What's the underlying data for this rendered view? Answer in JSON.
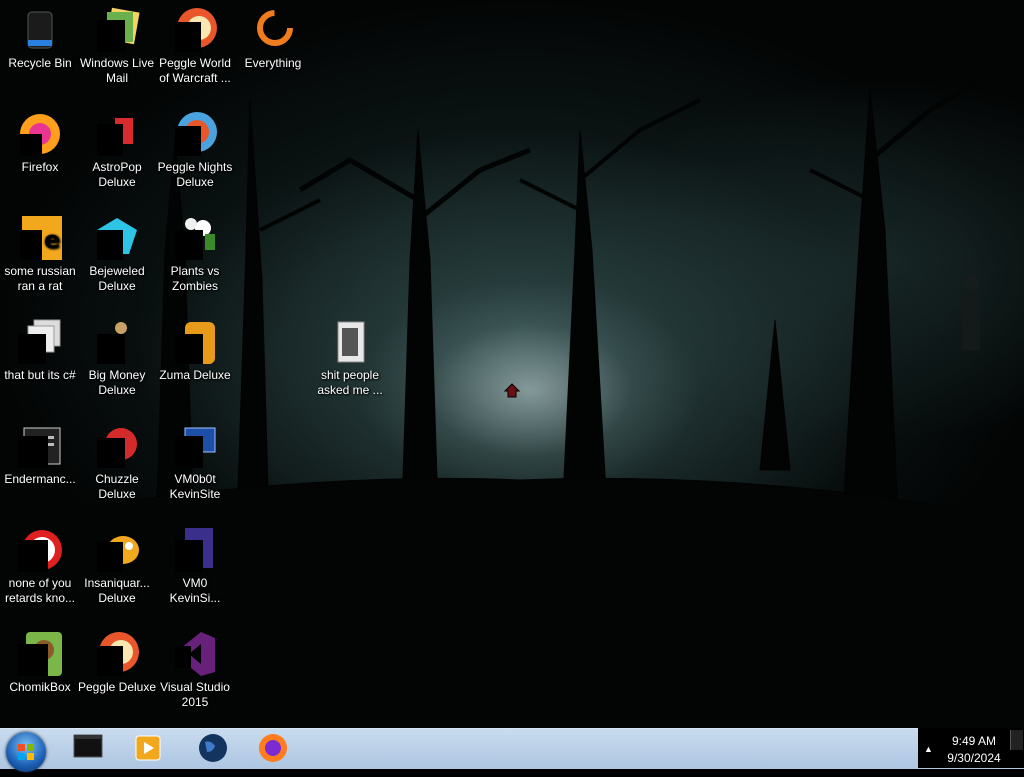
{
  "desktop": {
    "icons": [
      {
        "label": "Recycle Bin"
      },
      {
        "label": "Windows Live\nMail"
      },
      {
        "label": "Peggle World\nof Warcraft ..."
      },
      {
        "label": "Everything"
      },
      {
        "label": "Firefox"
      },
      {
        "label": "AstroPop\nDeluxe"
      },
      {
        "label": "Peggle Nights\nDeluxe"
      },
      {
        "label": "some russian\nran a rat"
      },
      {
        "label": "Bejeweled\nDeluxe"
      },
      {
        "label": "Plants vs\nZombies"
      },
      {
        "label": "that but its c#"
      },
      {
        "label": "Big Money\nDeluxe"
      },
      {
        "label": "Zuma Deluxe"
      },
      {
        "label": "shit people\nasked me ..."
      },
      {
        "label": "Endermanc..."
      },
      {
        "label": "Chuzzle\nDeluxe"
      },
      {
        "label": "VM0b0t\nKevinSite"
      },
      {
        "label": "none of you\nretards kno..."
      },
      {
        "label": "Insaniquar...\nDeluxe"
      },
      {
        "label": "VM0\nKevinSi..."
      },
      {
        "label": "ChomikBox"
      },
      {
        "label": "Peggle Deluxe"
      },
      {
        "label": "Visual Studio\n2015"
      }
    ]
  },
  "taskbar": {
    "pinned": [
      "black-window-icon",
      "media-player-icon",
      "earth-icon",
      "firefox-icon"
    ],
    "clock_time": "9:49 AM",
    "clock_date": "9/30/2024"
  },
  "colors": {
    "taskbar": "#b8cfe8",
    "accent": "#1a5fb4"
  }
}
